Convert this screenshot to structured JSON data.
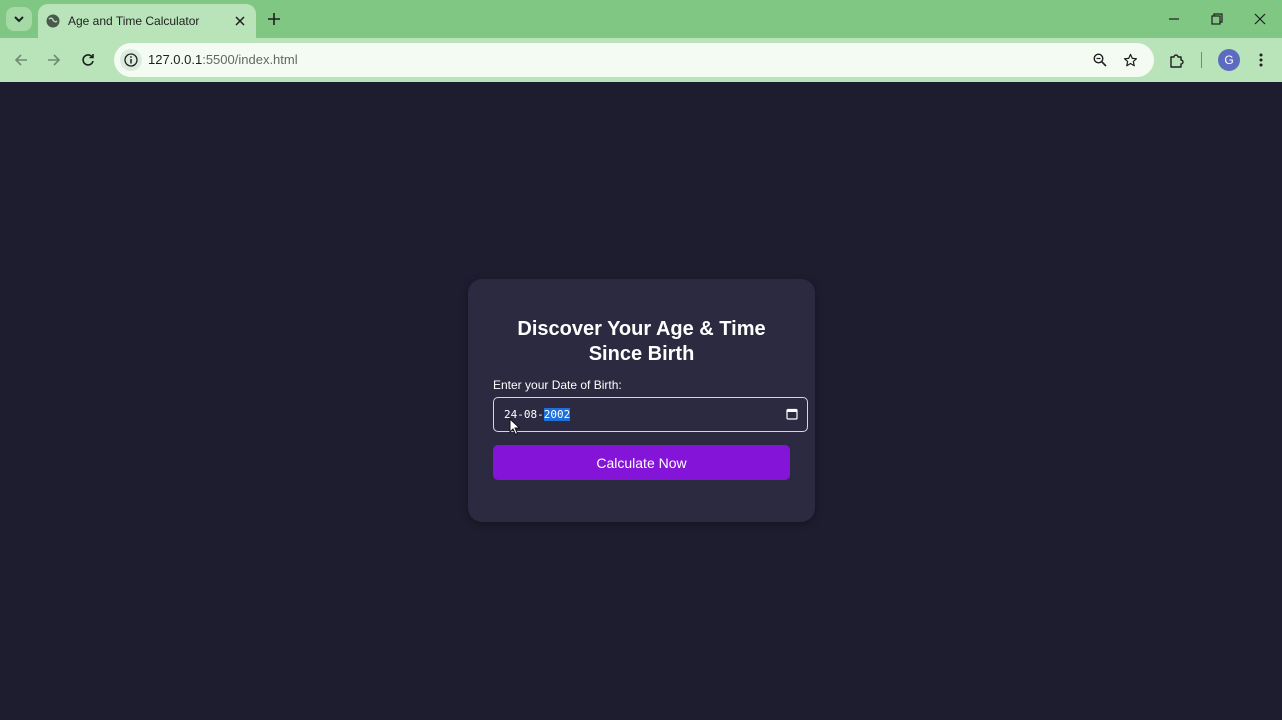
{
  "browser": {
    "tab_title": "Age and Time Calculator",
    "url_host": "127.0.0.1",
    "url_rest": ":5500/index.html",
    "profile_initial": "G",
    "tabbar_color": "#80c783",
    "toolbar_color": "#b9e4ba"
  },
  "page": {
    "heading": "Discover Your Age & Time Since Birth",
    "dob_label": "Enter your Date of Birth:",
    "dob_day_month": "24-08-",
    "dob_year_selected": "2002",
    "calculate_button": "Calculate Now",
    "background_color": "#1e1d2f",
    "card_color": "#2b2a40",
    "accent_color": "#8414d8"
  },
  "icons": [
    "tab-search-icon",
    "globe-favicon-icon",
    "close-tab-icon",
    "new-tab-icon",
    "minimize-icon",
    "restore-icon",
    "close-window-icon",
    "back-icon",
    "forward-icon",
    "reload-icon",
    "site-info-icon",
    "zoom-icon",
    "bookmark-star-icon",
    "extensions-icon",
    "menu-dots-icon",
    "calendar-icon",
    "mouse-cursor-icon"
  ]
}
